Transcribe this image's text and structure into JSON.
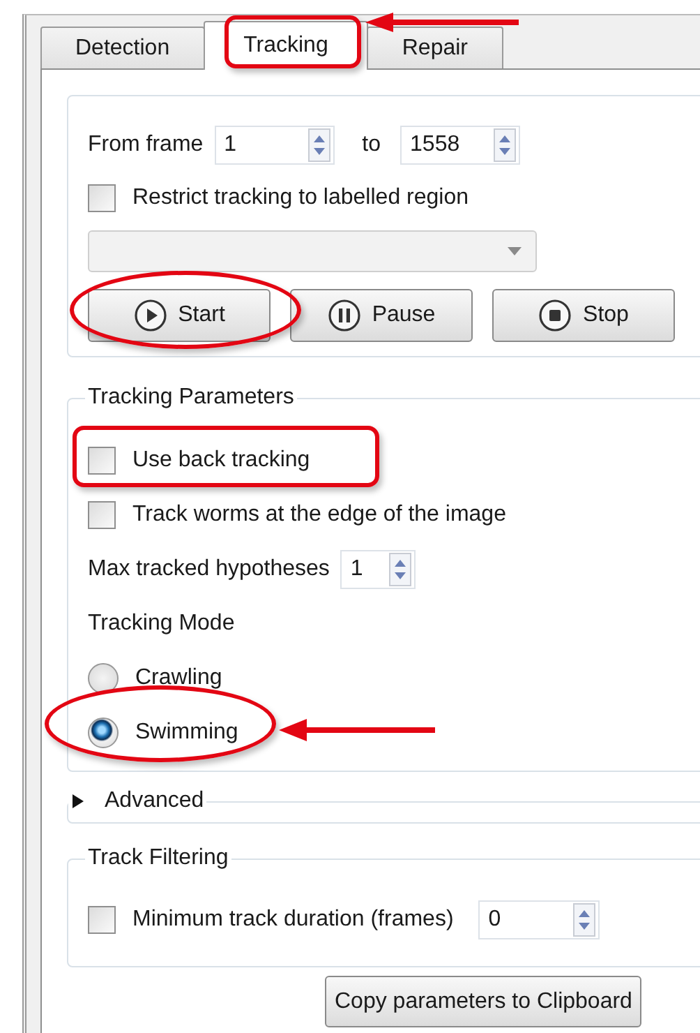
{
  "tabs": [
    {
      "label": "Detection",
      "selected": false
    },
    {
      "label": "Tracking",
      "selected": true
    },
    {
      "label": "Repair",
      "selected": false
    }
  ],
  "range": {
    "from_label": "From frame",
    "from_value": "1",
    "to_label": "to",
    "to_value": "1558"
  },
  "restrict": {
    "label": "Restrict tracking to labelled region",
    "checked": false
  },
  "region_dropdown": {
    "disabled": true
  },
  "actions": [
    {
      "kind": "play",
      "label": "Start"
    },
    {
      "kind": "pause",
      "label": "Pause"
    },
    {
      "kind": "stop",
      "label": "Stop"
    }
  ],
  "tracking_parameters": {
    "title": "Tracking Parameters",
    "options": [
      {
        "label": "Use back tracking",
        "checked": false
      },
      {
        "label": "Track worms at the edge of the image",
        "checked": false
      }
    ],
    "max_hypotheses": {
      "label": "Max tracked hypotheses",
      "value": "1"
    },
    "mode_label": "Tracking Mode",
    "modes": [
      {
        "label": "Crawling",
        "selected": false
      },
      {
        "label": "Swimming",
        "selected": true
      }
    ]
  },
  "advanced": {
    "title": "Advanced",
    "expanded": false
  },
  "track_filtering": {
    "title": "Track Filtering",
    "min_duration": {
      "label": "Minimum track duration (frames)",
      "checked": false,
      "value": "0"
    }
  },
  "copy_button": "Copy parameters to Clipboard"
}
